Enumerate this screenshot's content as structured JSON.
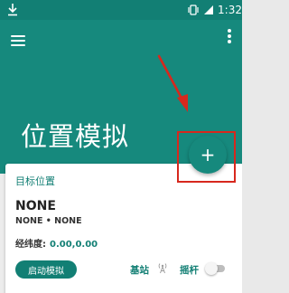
{
  "status_bar": {
    "time": "1:32",
    "icons": [
      "download-icon",
      "vibrate-icon",
      "signal-icon"
    ]
  },
  "header": {
    "title": "位置模拟",
    "menu_icon": "hamburger-menu-icon",
    "more_icon": "more-vert-icon"
  },
  "fab": {
    "icon": "+",
    "annotation_color": "#d7281d"
  },
  "card": {
    "section_label": "目标位置",
    "location_name": "NONE",
    "location_sub": "NONE • NONE",
    "latlng_label": "经纬度:",
    "latlng_value": "0.00,0.00",
    "start_button": "启动模拟",
    "base_station_label": "基站",
    "joystick_label": "摇杆",
    "joystick_enabled": false
  },
  "colors": {
    "primary": "#16897d",
    "primary_dark": "#127f74",
    "accent_red": "#d7281d"
  }
}
